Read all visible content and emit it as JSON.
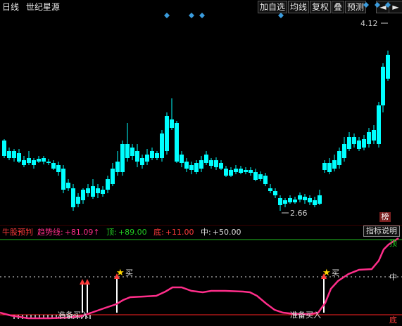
{
  "toolbar": {
    "period": "日线",
    "stock_name": "世纪星源",
    "buttons": [
      "加自选",
      "均线",
      "复权",
      "叠",
      "预测"
    ],
    "nav_icons": [
      "arrow-left-icon",
      "arrow-right-icon"
    ]
  },
  "price_labels": {
    "high": "4.12",
    "low": "2.66"
  },
  "bang_badge": "榜",
  "indicator": {
    "name": "牛股预判",
    "trend_label": "趋势线:",
    "trend_value": "+81.09↑",
    "top_label": "顶:",
    "top_value": "+89.00",
    "bottom_label": "底:",
    "bottom_value": "+11.00",
    "mid_label": "中:",
    "mid_value": "+50.00",
    "explain_button": "指标说明",
    "right_labels": {
      "top": "顶",
      "mid": "中",
      "bottom": "底"
    },
    "signals": {
      "buy": "买",
      "prepare_buy": "准备买入"
    }
  },
  "colors": {
    "up": "#ff3b3b",
    "down": "#00ffff",
    "trend": "#ff2e8a",
    "top_line": "#22bb22",
    "bottom_line": "#ff2222",
    "diamond": "#3a9bdc",
    "star": "#ffd700"
  }
}
